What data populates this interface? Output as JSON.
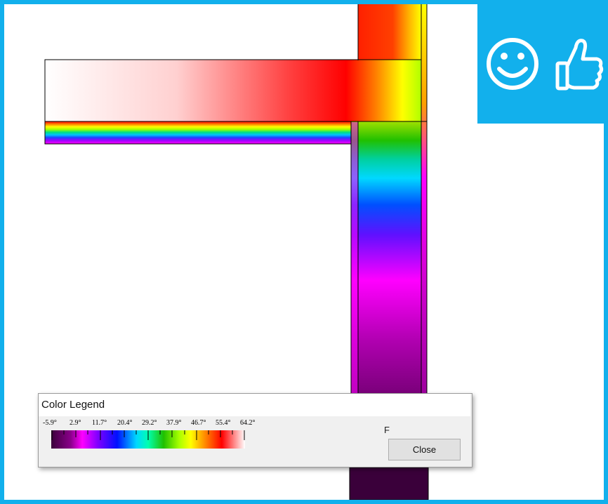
{
  "legend": {
    "title": "Color Legend",
    "tick_labels": [
      "-5.9°",
      "2.9°",
      "11.7°",
      "20.4°",
      "29.2°",
      "37.9°",
      "46.7°",
      "55.4°",
      "64.2°"
    ],
    "unit": "F",
    "close_label": "Close",
    "scale_min": -5.9,
    "scale_max": 64.2
  },
  "badge": {
    "icons": [
      "smiley-face-icon",
      "thumbs-up-icon"
    ],
    "color": "#12b0ec"
  },
  "colors": {
    "frame_accent": "#12b0ec"
  }
}
